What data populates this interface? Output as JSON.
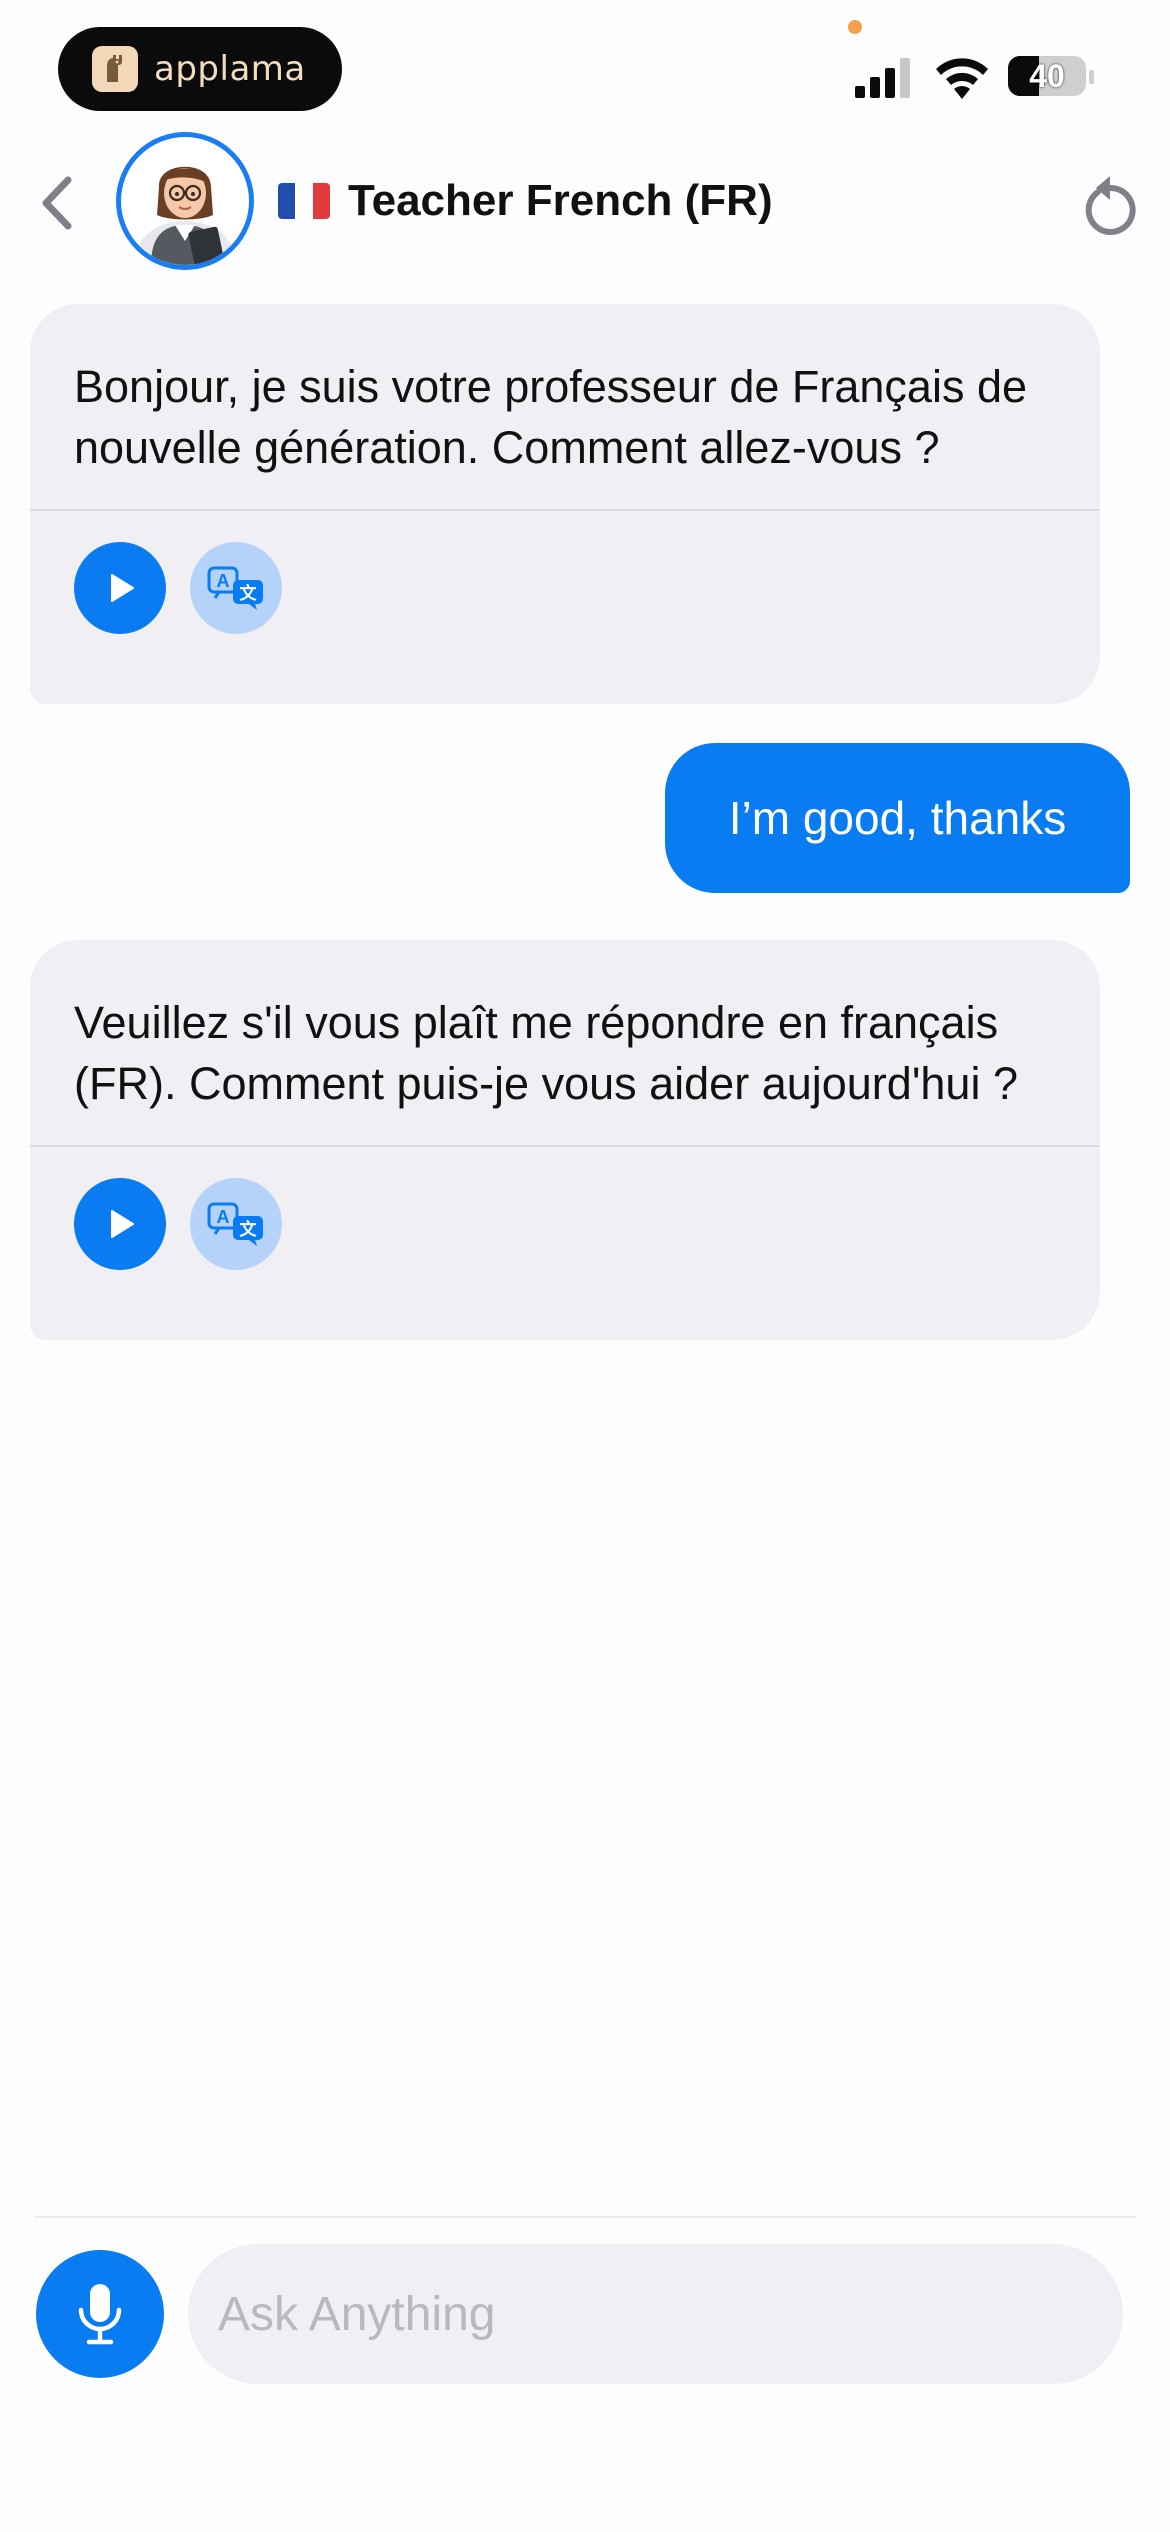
{
  "status_bar": {
    "app_badge": {
      "name": "applama",
      "icon": "llama-logo-icon"
    },
    "battery_level": "40",
    "icons": [
      "cellular-signal-icon",
      "wifi-icon",
      "battery-icon"
    ],
    "privacy_dot_color": "#f5a04a"
  },
  "header": {
    "title": "Teacher French (FR)",
    "flag": "french-flag-icon",
    "back_icon": "chevron-left-icon",
    "reset_icon": "reset-arrow-icon"
  },
  "messages": [
    {
      "role": "bot",
      "text": "Bonjour, je suis votre professeur de Français de nouvelle génération. Comment allez-vous ?",
      "actions": [
        "play-icon",
        "translate-icon"
      ]
    },
    {
      "role": "user",
      "text": "I’m good, thanks"
    },
    {
      "role": "bot",
      "text": "Veuillez s'il vous plaît me répondre en français (FR). Comment puis-je vous aider aujourd'hui ?",
      "actions": [
        "play-icon",
        "translate-icon"
      ]
    }
  ],
  "input": {
    "placeholder": "Ask Anything",
    "value": "",
    "mic_icon": "microphone-icon"
  },
  "colors": {
    "accent": "#0a7cf2",
    "bot_bubble": "#f0f0f4",
    "translate_bg": "#b5d2f8"
  }
}
